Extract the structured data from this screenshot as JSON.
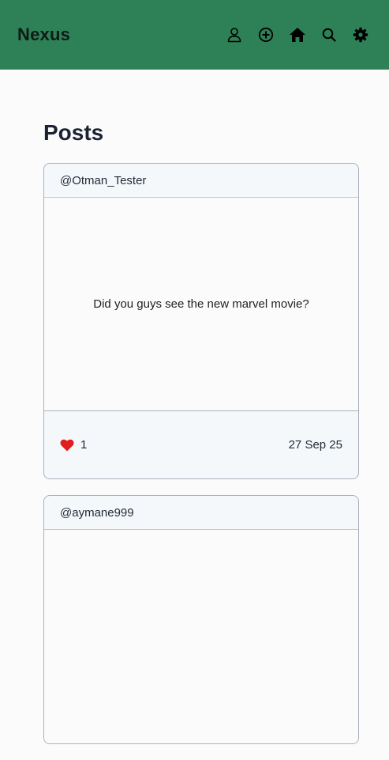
{
  "app": {
    "brand": "Nexus"
  },
  "nav": {
    "icons": [
      "profile-icon",
      "add-post-icon",
      "home-icon",
      "search-icon",
      "settings-icon"
    ]
  },
  "page": {
    "title": "Posts"
  },
  "posts": [
    {
      "author": "@Otman_Tester",
      "content": "Did you guys see the new marvel movie?",
      "likes": "1",
      "date": "27 Sep 25",
      "liked": true
    },
    {
      "author": "@aymane999",
      "content": ""
    }
  ],
  "colors": {
    "navbar": "#2e8157",
    "heart": "#e11d1d",
    "card_border": "#a9b0be",
    "card_bg": "#f5f8fb"
  }
}
